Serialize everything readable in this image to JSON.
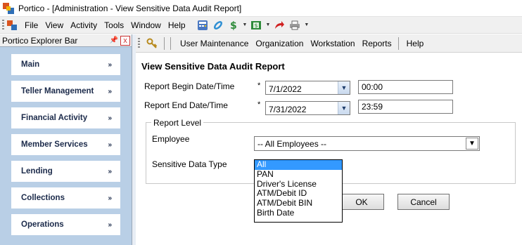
{
  "window": {
    "title": "Portico - [Administration - View Sensitive Data Audit Report]"
  },
  "menubar": {
    "items": [
      "File",
      "View",
      "Activity",
      "Tools",
      "Window",
      "Help"
    ]
  },
  "explorer": {
    "title": "Portico Explorer Bar",
    "close_label": "x",
    "items": [
      {
        "label": "Main"
      },
      {
        "label": "Teller Management"
      },
      {
        "label": "Financial Activity"
      },
      {
        "label": "Member Services"
      },
      {
        "label": "Lending"
      },
      {
        "label": "Collections"
      },
      {
        "label": "Operations"
      }
    ]
  },
  "toolbar": {
    "links": [
      "User Maintenance",
      "Organization",
      "Workstation",
      "Reports",
      "Help"
    ]
  },
  "form": {
    "title": "View Sensitive Data Audit Report",
    "begin_label": "Report Begin Date/Time",
    "end_label": "Report End Date/Time",
    "required_mark": "*",
    "begin_date": "7/1/2022",
    "begin_time": "00:00",
    "end_date": "7/31/2022",
    "end_time": "23:59",
    "group_title": "Report Level",
    "employee_label": "Employee",
    "employee_value": "-- All Employees --",
    "sensitive_label": "Sensitive Data Type",
    "sensitive_options": [
      "All",
      "PAN",
      "Driver's License",
      "ATM/Debit ID",
      "ATM/Debit BIN",
      "Birth Date"
    ],
    "sensitive_selected": "All",
    "ok_label": "OK",
    "cancel_label": "Cancel"
  },
  "colors": {
    "explorer_bg": "#b9cfe6",
    "selection": "#3399ff",
    "nav_text": "#1b2a4a"
  }
}
